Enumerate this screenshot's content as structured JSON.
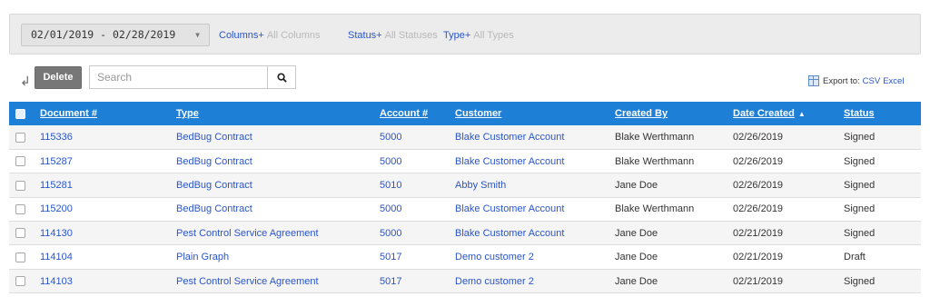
{
  "filters": {
    "date_range": "02/01/2019 - 02/28/2019",
    "columns_label": "Columns+",
    "columns_value": "All Columns",
    "status_label": "Status+",
    "status_value": "All Statuses",
    "type_label": "Type+",
    "type_value": "All Types"
  },
  "toolbar": {
    "delete_label": "Delete",
    "search_placeholder": "Search",
    "export_label": "Export to:",
    "export_options": [
      "CSV",
      "Excel"
    ]
  },
  "table": {
    "headers": [
      "Document #",
      "Type",
      "Account #",
      "Customer",
      "Created By",
      "Date Created",
      "Status"
    ],
    "sort_indicator": "▲",
    "rows": [
      [
        "115336",
        "BedBug Contract",
        "5000",
        "Blake Customer Account",
        "Blake Werthmann",
        "02/26/2019",
        "Signed"
      ],
      [
        "115287",
        "BedBug Contract",
        "5000",
        "Blake Customer Account",
        "Blake Werthmann",
        "02/26/2019",
        "Signed"
      ],
      [
        "115281",
        "BedBug Contract",
        "5010",
        "Abby Smith",
        "Jane Doe",
        "02/26/2019",
        "Signed"
      ],
      [
        "115200",
        "BedBug Contract",
        "5000",
        "Blake Customer Account",
        "Blake Werthmann",
        "02/26/2019",
        "Signed"
      ],
      [
        "114130",
        "Pest Control Service Agreement",
        "5000",
        "Blake Customer Account",
        "Jane Doe",
        "02/21/2019",
        "Signed"
      ],
      [
        "114104",
        "Plain Graph",
        "5017",
        "Demo customer 2",
        "Jane Doe",
        "02/21/2019",
        "Draft"
      ],
      [
        "114103",
        "Pest Control Service Agreement",
        "5017",
        "Demo customer 2",
        "Jane Doe",
        "02/21/2019",
        "Signed"
      ]
    ]
  },
  "colors": {
    "header_bg": "#1d7fd6",
    "link": "#2a55c8",
    "delete_bg": "#777777"
  }
}
